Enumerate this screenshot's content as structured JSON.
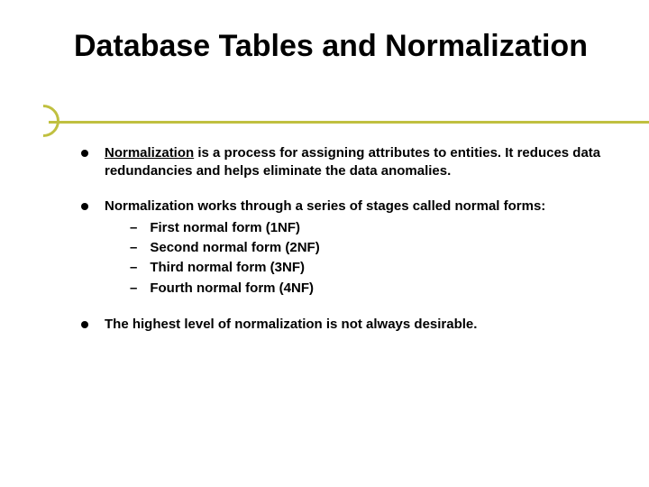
{
  "title": "Database Tables and Normalization",
  "bullets": [
    {
      "prefix_under": "Normalization",
      "rest": " is a process for assigning attributes to entities. It reduces data redundancies and helps eliminate the data anomalies."
    },
    {
      "text": "Normalization works through a series of stages called normal forms:",
      "subs": [
        "First normal form (1NF)",
        "Second normal form (2NF)",
        "Third normal form (3NF)",
        "Fourth normal form (4NF)"
      ]
    },
    {
      "text": "The highest level of normalization is not always desirable."
    }
  ]
}
